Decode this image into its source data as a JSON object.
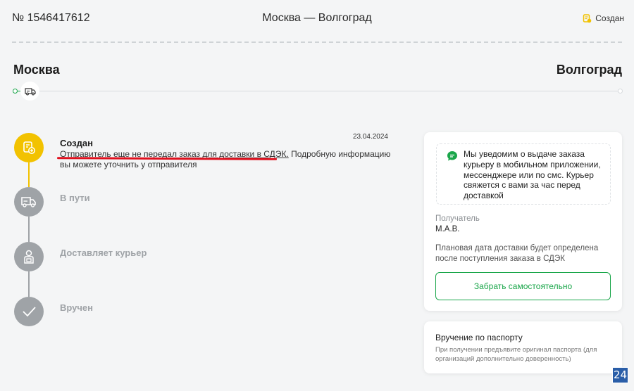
{
  "header": {
    "order_number": "№ 1546417612",
    "route": "Москва — Волгоград",
    "status": "Создан"
  },
  "route": {
    "from": "Москва",
    "to": "Волгоград"
  },
  "timeline": {
    "steps": [
      {
        "title": "Создан",
        "date": "23.04.2024",
        "icon": "package-add-icon",
        "active": true
      },
      {
        "title": "В пути",
        "icon": "truck-icon",
        "active": false
      },
      {
        "title": "Доставляет курьер",
        "icon": "courier-icon",
        "active": false
      },
      {
        "title": "Вручен",
        "icon": "check-icon",
        "active": false
      }
    ],
    "description_underlined": "Отправитель еще не передал заказ для доставки в СДЭК.",
    "description_rest": " Подробную информацию вы можете уточнить у отправителя"
  },
  "delivery_card": {
    "notice": "Мы уведомим о выдаче заказа курьеру в мобильном приложении, мессенджере или по смс. Курьер свяжется с вами за час перед доставкой",
    "recipient_label": "Получатель",
    "recipient_value": "М.А.В.",
    "plan_text": "Плановая дата доставки будет определена после поступления заказа в СДЭК",
    "pickup_button": "Забрать самостоятельно"
  },
  "passport_card": {
    "title": "Вручение по паспорту",
    "text": "При получении предъявите оригинал паспорта (для организаций дополнительно доверенность)"
  },
  "badge": "24",
  "colors": {
    "accent_green": "#1aa64a",
    "active_yellow": "#f2c200",
    "idle_gray": "#9fa3a7",
    "highlight_red": "#e0101e"
  }
}
